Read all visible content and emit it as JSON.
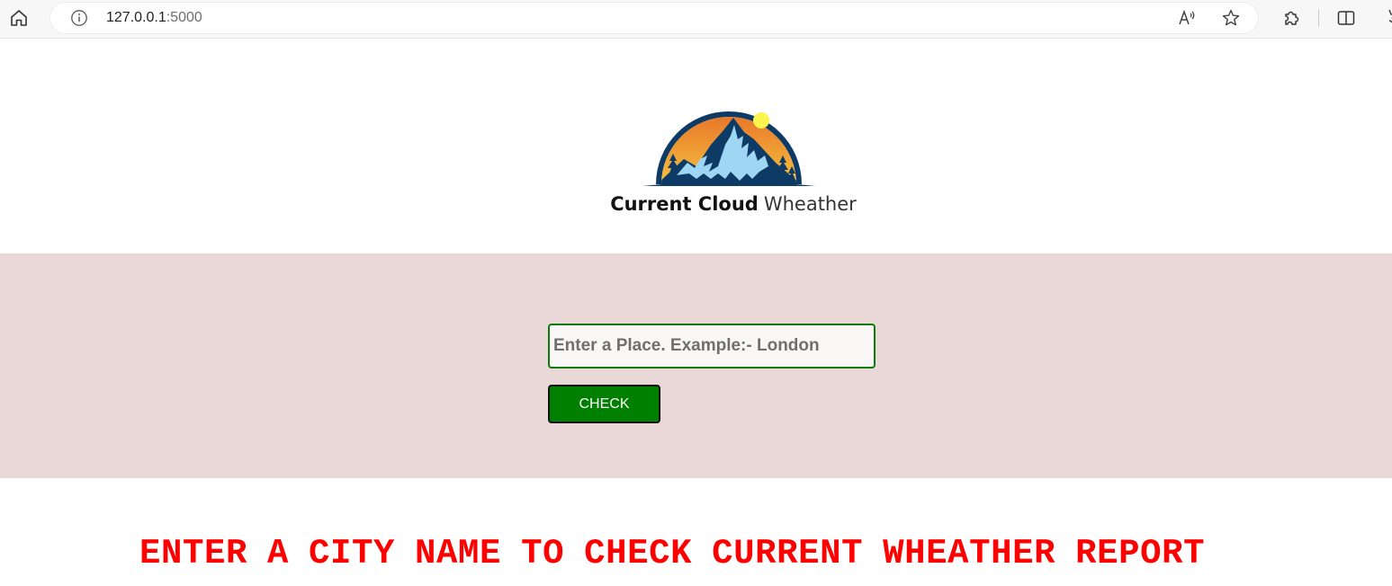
{
  "browser": {
    "url_host": "127.0.0.1",
    "url_port": ":5000",
    "icons": [
      "home-icon",
      "info-icon",
      "read-aloud-icon",
      "favorite-star-icon",
      "extensions-icon",
      "split-screen-icon",
      "favorites-bar-icon"
    ]
  },
  "logo": {
    "name_bold": "Current Cloud",
    "name_light": "Wheather",
    "colors": {
      "ring": "#0d3b66",
      "sky_top": "#e8782a",
      "sky_bottom": "#f6c23e",
      "sun": "#fff34d",
      "mountain": "#9fd6f3"
    }
  },
  "search": {
    "placeholder": "Enter a Place. Example:- London",
    "value": "",
    "button_label": "CHECK"
  },
  "message": "ENTER A CITY NAME TO CHECK CURRENT WHEATHER REPORT",
  "colors": {
    "search_band": "#ead7d7",
    "button": "#008000",
    "input_border": "#0a7a0a",
    "message": "#ff0000"
  }
}
